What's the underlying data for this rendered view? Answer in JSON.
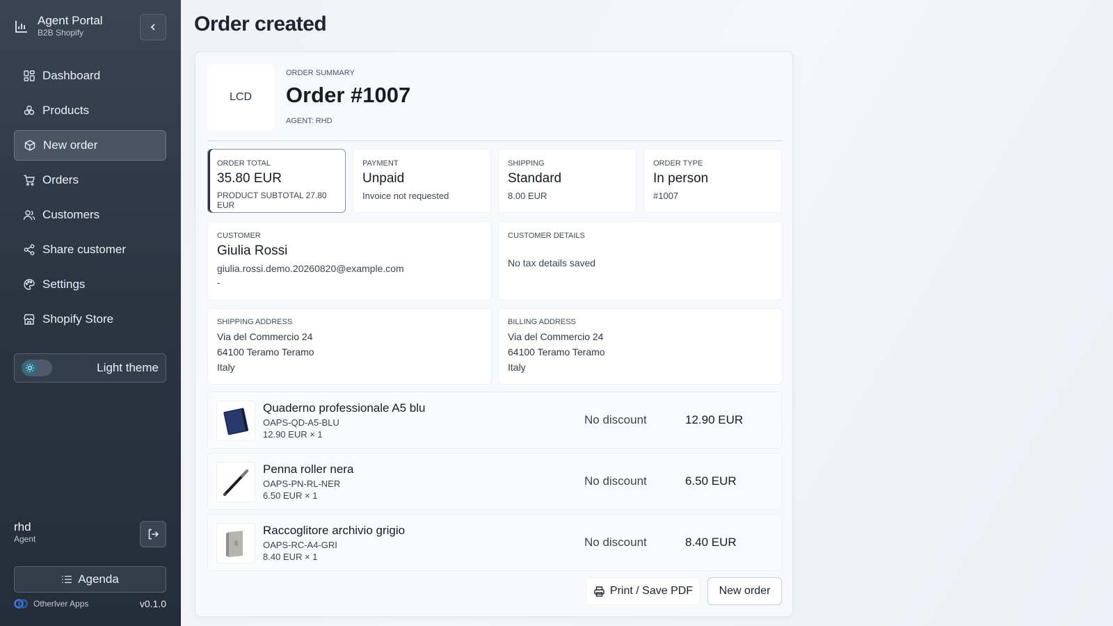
{
  "sidebar": {
    "brand_title": "Agent Portal",
    "brand_subtitle": "B2B Shopify",
    "items": [
      {
        "label": "Dashboard",
        "icon": "dashboard-icon"
      },
      {
        "label": "Products",
        "icon": "products-icon"
      },
      {
        "label": "New order",
        "icon": "new-order-icon",
        "active": true
      },
      {
        "label": "Orders",
        "icon": "cart-icon"
      },
      {
        "label": "Customers",
        "icon": "users-icon"
      },
      {
        "label": "Share customer",
        "icon": "share-icon"
      },
      {
        "label": "Settings",
        "icon": "palette-icon"
      },
      {
        "label": "Shopify Store",
        "icon": "store-icon"
      }
    ],
    "theme_label": "Light theme",
    "user_name": "rhd",
    "user_role": "Agent",
    "agenda_label": "Agenda",
    "footer_company": "Otherlver Apps",
    "version": "v0.1.0"
  },
  "page": {
    "title": "Order created"
  },
  "order": {
    "logo_text": "LCD",
    "summary_label": "ORDER SUMMARY",
    "title": "Order #1007",
    "agent_line": "AGENT: RHD",
    "total": {
      "label": "ORDER TOTAL",
      "value": "35.80 EUR",
      "sub": "PRODUCT SUBTOTAL 27.80 EUR"
    },
    "payment": {
      "label": "PAYMENT",
      "value": "Unpaid",
      "sub": "Invoice not requested"
    },
    "shipping": {
      "label": "SHIPPING",
      "value": "Standard",
      "sub": "8.00 EUR"
    },
    "order_type": {
      "label": "ORDER TYPE",
      "value": "In person",
      "sub": "#1007"
    },
    "customer": {
      "label": "CUSTOMER",
      "name": "Giulia Rossi",
      "email": "giulia.rossi.demo.20260820@example.com",
      "extra": "-"
    },
    "customer_details": {
      "label": "CUSTOMER DETAILS",
      "text": "No tax details saved"
    },
    "shipping_address": {
      "label": "SHIPPING ADDRESS",
      "lines": [
        "Via del Commercio 24",
        "64100 Teramo Teramo",
        "Italy"
      ]
    },
    "billing_address": {
      "label": "BILLING ADDRESS",
      "lines": [
        "Via del Commercio 24",
        "64100 Teramo Teramo",
        "Italy"
      ]
    },
    "items": [
      {
        "name": "Quaderno professionale A5 blu",
        "sku": "OAPS-QD-A5-BLU",
        "qty": "12.90 EUR × 1",
        "discount": "No discount",
        "price": "12.90 EUR",
        "thumb": "notebook-thumb"
      },
      {
        "name": "Penna roller nera",
        "sku": "OAPS-PN-RL-NER",
        "qty": "6.50 EUR × 1",
        "discount": "No discount",
        "price": "6.50 EUR",
        "thumb": "pen-thumb"
      },
      {
        "name": "Raccoglitore archivio grigio",
        "sku": "OAPS-RC-A4-GRI",
        "qty": "8.40 EUR × 1",
        "discount": "No discount",
        "price": "8.40 EUR",
        "thumb": "binder-thumb"
      }
    ],
    "print_label": "Print / Save PDF",
    "new_order_label": "New order"
  }
}
